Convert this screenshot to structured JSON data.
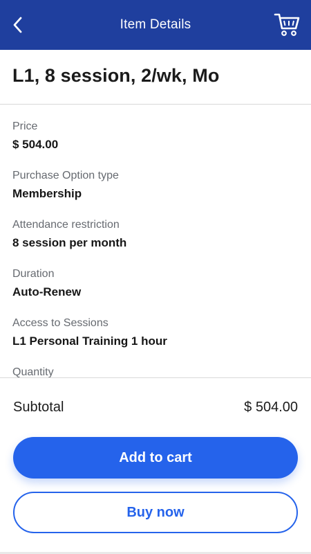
{
  "header": {
    "title": "Item Details",
    "back_icon": "chevron-left",
    "cart_icon": "shopping-cart",
    "background_color": "#1f3f9e"
  },
  "item": {
    "title": "L1, 8 session, 2/wk, Mo"
  },
  "details": [
    {
      "label": "Price",
      "value": "$ 504.00"
    },
    {
      "label": "Purchase Option type",
      "value": "Membership"
    },
    {
      "label": "Attendance restriction",
      "value": "8 session per month"
    },
    {
      "label": "Duration",
      "value": "Auto-Renew"
    },
    {
      "label": "Access to Sessions",
      "value": "L1 Personal Training 1 hour"
    },
    {
      "label": "Quantity",
      "value": ""
    }
  ],
  "summary": {
    "subtotal_label": "Subtotal",
    "subtotal_value": "$ 504.00"
  },
  "actions": {
    "add_to_cart_label": "Add to cart",
    "buy_now_label": "Buy now",
    "accent_color": "#2563eb"
  }
}
